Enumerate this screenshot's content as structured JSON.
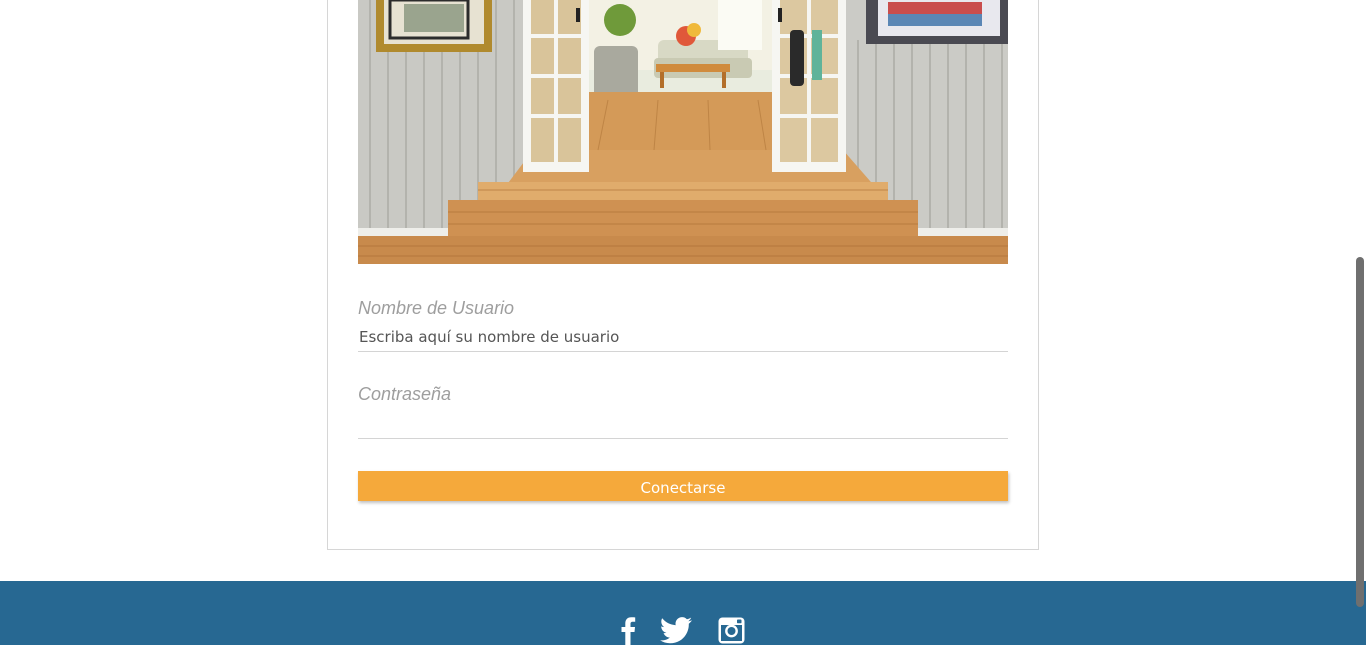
{
  "login": {
    "username": {
      "label": "Nombre de Usuario",
      "placeholder": "Escriba aquí su nombre de usuario",
      "value": ""
    },
    "password": {
      "label": "Contraseña",
      "placeholder": "",
      "value": ""
    },
    "submit_label": "Conectarse"
  },
  "footer": {
    "social": [
      "facebook-icon",
      "twitter-icon",
      "instagram-icon"
    ]
  },
  "colors": {
    "accent": "#f5a93b",
    "footer": "#276892",
    "label": "#9e9e9e"
  }
}
